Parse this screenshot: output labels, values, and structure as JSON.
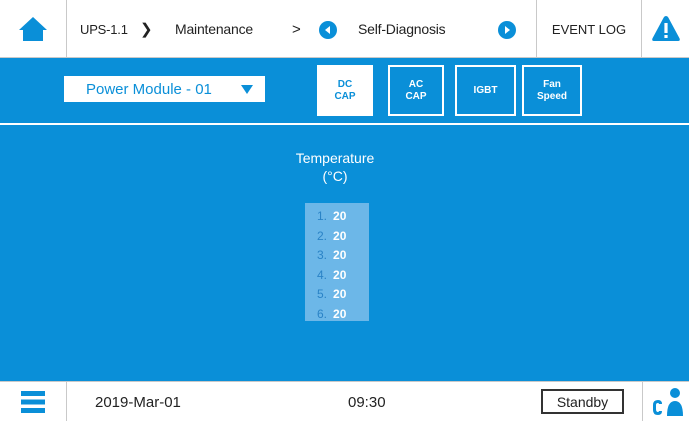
{
  "colors": {
    "accent": "#0a8fd8",
    "list_bg": "#6cb7e8",
    "white": "#ffffff"
  },
  "icons": {
    "home": "home-icon",
    "prev": "chevron-left-circle-icon",
    "next": "chevron-right-circle-icon",
    "alarm": "warning-triangle-icon",
    "menu": "hamburger-menu-icon",
    "user": "user-icon",
    "dropdown": "caret-down-icon"
  },
  "header": {
    "device": "UPS-1.1",
    "sep1": "❯",
    "section": "Maintenance",
    "sep2": ">",
    "page": "Self-Diagnosis",
    "event_log": "EVENT LOG"
  },
  "toolbar": {
    "module_select": "Power Module - 01",
    "tabs": [
      {
        "label": "DC\nCAP",
        "active": true
      },
      {
        "label": "AC\nCAP",
        "active": false
      },
      {
        "label": "IGBT",
        "active": false
      },
      {
        "label": "Fan\nSpeed",
        "active": false
      }
    ]
  },
  "main": {
    "title": "Temperature",
    "unit": "(°C)",
    "readings": [
      {
        "index": "1.",
        "value": "20"
      },
      {
        "index": "2.",
        "value": "20"
      },
      {
        "index": "3.",
        "value": "20"
      },
      {
        "index": "4.",
        "value": "20"
      },
      {
        "index": "5.",
        "value": "20"
      },
      {
        "index": "6.",
        "value": "20"
      }
    ]
  },
  "footer": {
    "date": "2019-Mar-01",
    "time": "09:30",
    "status": "Standby"
  }
}
